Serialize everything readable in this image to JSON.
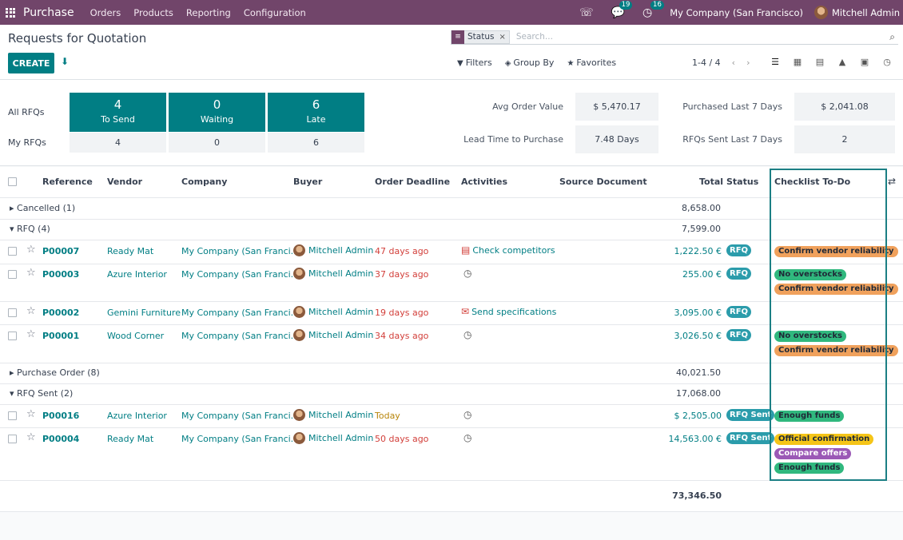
{
  "navbar": {
    "brand": "Purchase",
    "menu": [
      "Orders",
      "Products",
      "Reporting",
      "Configuration"
    ],
    "messages_count": "19",
    "activities_count": "16",
    "company": "My Company (San Francisco)",
    "user": "Mitchell Admin"
  },
  "control": {
    "title": "Requests for Quotation",
    "create_label": "CREATE",
    "facet_label": "Status",
    "search_placeholder": "Search...",
    "filters_label": "Filters",
    "groupby_label": "Group By",
    "favorites_label": "Favorites",
    "pager": "1-4 / 4"
  },
  "dashboard": {
    "all_label": "All RFQs",
    "my_label": "My RFQs",
    "tiles": [
      {
        "num": "4",
        "label": "To Send",
        "my": "4"
      },
      {
        "num": "0",
        "label": "Waiting",
        "my": "0"
      },
      {
        "num": "6",
        "label": "Late",
        "my": "6"
      }
    ],
    "kpis": [
      {
        "label": "Avg Order Value",
        "value": "$ 5,470.17"
      },
      {
        "label": "Purchased Last 7 Days",
        "value": "$ 2,041.08"
      },
      {
        "label": "Lead Time to Purchase",
        "value": "7.48 Days"
      },
      {
        "label": "RFQs Sent Last 7 Days",
        "value": "2"
      }
    ]
  },
  "columns": [
    "Reference",
    "Vendor",
    "Company",
    "Buyer",
    "Order Deadline",
    "Activities",
    "Source Document",
    "Total",
    "Status",
    "Checklist To-Do"
  ],
  "groups": [
    {
      "label": "Cancelled (1)",
      "total": "8,658.00"
    },
    {
      "label": "RFQ (4)",
      "total": "7,599.00"
    },
    {
      "label": "Purchase Order (8)",
      "total": "40,021.50"
    },
    {
      "label": "RFQ Sent (2)",
      "total": "17,068.00"
    }
  ],
  "rows": [
    {
      "ref": "P00007",
      "vendor": "Ready Mat",
      "company": "My Company (San Franci...",
      "buyer": "Mitchell Admin",
      "deadline": "47 days ago",
      "activity": "Check competitors",
      "total": "1,222.50 €",
      "status": "RFQ",
      "tags": [
        "Confirm vendor reliability"
      ]
    },
    {
      "ref": "P00003",
      "vendor": "Azure Interior",
      "company": "My Company (San Franci...",
      "buyer": "Mitchell Admin",
      "deadline": "37 days ago",
      "activity": "",
      "total": "255.00 €",
      "status": "RFQ",
      "tags": [
        "No overstocks",
        "Confirm vendor reliability"
      ]
    },
    {
      "ref": "P00002",
      "vendor": "Gemini Furniture",
      "company": "My Company (San Franci...",
      "buyer": "Mitchell Admin",
      "deadline": "19 days ago",
      "activity": "Send specifications",
      "total": "3,095.00 €",
      "status": "RFQ",
      "tags": []
    },
    {
      "ref": "P00001",
      "vendor": "Wood Corner",
      "company": "My Company (San Franci...",
      "buyer": "Mitchell Admin",
      "deadline": "34 days ago",
      "activity": "",
      "total": "3,026.50 €",
      "status": "RFQ",
      "tags": [
        "No overstocks",
        "Confirm vendor reliability"
      ]
    },
    {
      "ref": "P00016",
      "vendor": "Azure Interior",
      "company": "My Company (San Franci...",
      "buyer": "Mitchell Admin",
      "deadline": "Today",
      "activity": "",
      "total": "$ 2,505.00",
      "status": "RFQ Sent",
      "tags": [
        "Enough funds"
      ]
    },
    {
      "ref": "P00004",
      "vendor": "Ready Mat",
      "company": "My Company (San Franci...",
      "buyer": "Mitchell Admin",
      "deadline": "50 days ago",
      "activity": "",
      "total": "14,563.00 €",
      "status": "RFQ Sent",
      "tags": [
        "Official confirmation",
        "Compare offers",
        "Enough funds"
      ]
    }
  ],
  "grand_total": "73,346.50",
  "colors": {
    "primary": "#71456a",
    "accent": "#017e84",
    "overdue": "#d23f3a"
  }
}
